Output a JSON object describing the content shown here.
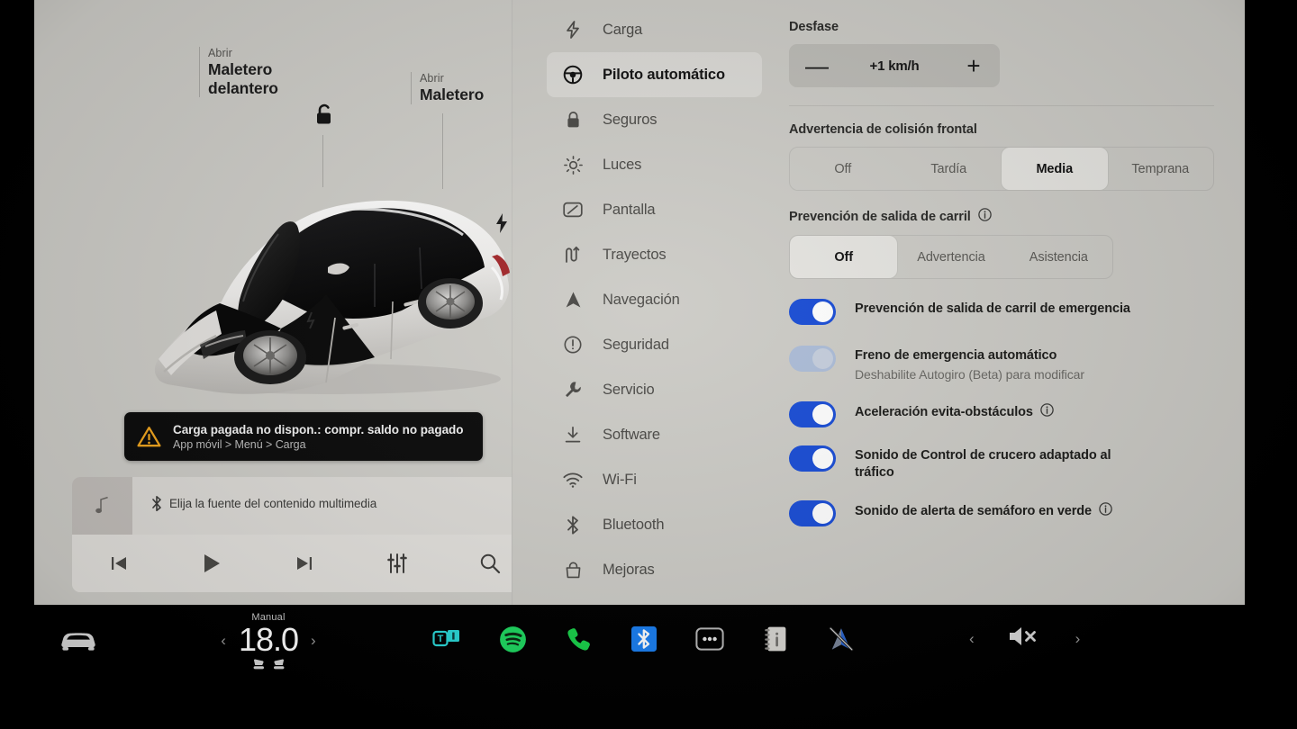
{
  "car_panel": {
    "callouts": [
      {
        "sub": "Abrir",
        "main": "Maletero delantero"
      },
      {
        "sub": "Abrir",
        "main": "Maletero"
      }
    ],
    "unlock_icon": "unlock-icon",
    "charge_port_icon": "charge-bolt-icon",
    "vehicle_image": "tesla-model-3-white-frunk-open",
    "notification": {
      "icon": "warning-triangle-icon",
      "title": "Carga pagada no dispon.: compr. saldo no pagado",
      "subtitle": "App móvil > Menú > Carga",
      "accent": "#f0a51e"
    },
    "media": {
      "album_art_icon": "music-note-icon",
      "source_icon": "bluetooth-icon",
      "source_text": "Elija la fuente del contenido multimedia",
      "controls": [
        {
          "name": "previous-track-button",
          "icon": "skip-back-icon"
        },
        {
          "name": "play-button",
          "icon": "play-icon"
        },
        {
          "name": "next-track-button",
          "icon": "skip-forward-icon"
        },
        {
          "name": "equalizer-button",
          "icon": "sliders-icon"
        },
        {
          "name": "search-button",
          "icon": "search-icon"
        }
      ]
    }
  },
  "settings": {
    "nav_items": [
      {
        "label": "Carga",
        "icon": "bolt-icon",
        "active": false
      },
      {
        "label": "Piloto automático",
        "icon": "steering-wheel-icon",
        "active": true
      },
      {
        "label": "Seguros",
        "icon": "lock-icon",
        "active": false
      },
      {
        "label": "Luces",
        "icon": "sun-icon",
        "active": false
      },
      {
        "label": "Pantalla",
        "icon": "display-icon",
        "active": false
      },
      {
        "label": "Trayectos",
        "icon": "trips-icon",
        "active": false
      },
      {
        "label": "Navegación",
        "icon": "navigation-arrow-icon",
        "active": false
      },
      {
        "label": "Seguridad",
        "icon": "alert-circle-icon",
        "active": false
      },
      {
        "label": "Servicio",
        "icon": "wrench-icon",
        "active": false
      },
      {
        "label": "Software",
        "icon": "download-icon",
        "active": false
      },
      {
        "label": "Wi-Fi",
        "icon": "wifi-icon",
        "active": false
      },
      {
        "label": "Bluetooth",
        "icon": "bluetooth-icon",
        "active": false
      },
      {
        "label": "Mejoras",
        "icon": "upgrades-bag-icon",
        "active": false
      }
    ],
    "offset": {
      "label": "Desfase",
      "value": "+1 km/h",
      "minus": "—",
      "plus": "+"
    },
    "forward_collision": {
      "label": "Advertencia de colisión frontal",
      "options": [
        "Off",
        "Tardía",
        "Media",
        "Temprana"
      ],
      "selected": "Media"
    },
    "lane_departure": {
      "label": "Prevención de salida de carril",
      "has_info": true,
      "options": [
        "Off",
        "Advertencia",
        "Asistencia"
      ],
      "selected": "Off"
    },
    "toggles": [
      {
        "title": "Prevención de salida de carril de emergencia",
        "subtitle": "",
        "state": "on",
        "has_info": false
      },
      {
        "title": "Freno de emergencia automático",
        "subtitle": "Deshabilite Autogiro (Beta) para modificar",
        "state": "disabled",
        "has_info": false
      },
      {
        "title": "Aceleración evita-obstáculos",
        "subtitle": "",
        "state": "on",
        "has_info": true
      },
      {
        "title": "Sonido de Control de crucero adaptado al tráfico",
        "subtitle": "",
        "state": "on",
        "has_info": false
      },
      {
        "title": "Sonido de alerta de semáforo en verde",
        "subtitle": "",
        "state": "on",
        "has_info": true
      }
    ],
    "colors": {
      "toggle_on": "#1b4ed6",
      "toggle_disabled": "#adbdd8",
      "panel_bg": "#cdccc7",
      "selected_pill": "#e6e5e1"
    }
  },
  "taskbar": {
    "car_icon": "car-front-icon",
    "climate": {
      "mode_label": "Manual",
      "temperature": "18.0",
      "left_chevron": "‹",
      "right_chevron": "›",
      "seat_icons": [
        "seat-heater-left-icon",
        "seat-heater-right-icon"
      ]
    },
    "apps": [
      {
        "name": "tidal-app-icon",
        "label": "T",
        "color": "#2ad7d7"
      },
      {
        "name": "spotify-app-icon",
        "color": "#1ed760"
      },
      {
        "name": "phone-app-icon",
        "color": "#19d04a"
      },
      {
        "name": "bluetooth-app-icon",
        "color": "#1a7ef0"
      },
      {
        "name": "more-apps-icon",
        "color": "#cfcfcf"
      },
      {
        "name": "owners-manual-icon",
        "color": "#d8d6d2"
      },
      {
        "name": "navigation-muted-icon",
        "color": "#2f6ddb"
      }
    ],
    "volume": {
      "left_chevron": "‹",
      "icon": "volume-mute-icon",
      "right_chevron": "›"
    }
  }
}
